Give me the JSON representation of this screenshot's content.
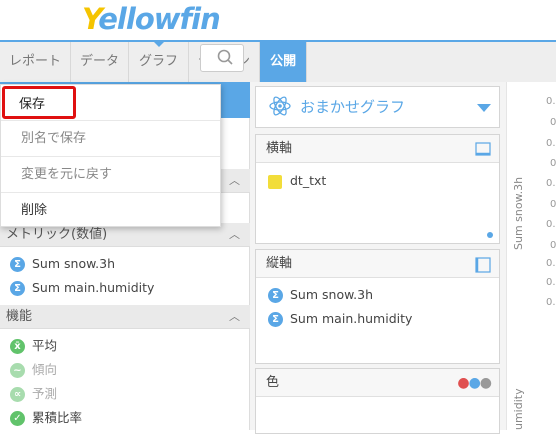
{
  "logo": {
    "y": "Y",
    "rest": "ellowfin"
  },
  "tabs": [
    {
      "label": "レポート"
    },
    {
      "label": "データ"
    },
    {
      "label": "グラフ"
    },
    {
      "label": "デザイン"
    },
    {
      "label": "公開"
    }
  ],
  "menu": {
    "save": "保存",
    "save_as": "別名で保存",
    "revert": "変更を元に戻す",
    "delete": "削除"
  },
  "left_panel": {
    "metrics_header": "メトリック(数値)",
    "metrics": [
      "Sum snow.3h",
      "Sum main.humidity"
    ],
    "functions_header": "機能",
    "functions": [
      {
        "label": "平均",
        "icon": "average-icon",
        "enabled": true
      },
      {
        "label": "傾向",
        "icon": "trend-icon",
        "enabled": false
      },
      {
        "label": "予測",
        "icon": "forecast-icon",
        "enabled": false
      },
      {
        "label": "累積比率",
        "icon": "cumulative-icon",
        "enabled": true
      }
    ]
  },
  "chart": {
    "selector_label": "おまかせグラフ",
    "x_axis_header": "横軸",
    "x_axis_fields": [
      "dt_txt"
    ],
    "y_axis_header": "縦軸",
    "y_axis_fields": [
      "Sum snow.3h",
      "Sum main.humidity"
    ],
    "color_header": "色"
  },
  "preview": {
    "y_label": "Sum snow.3h",
    "y_label2": "umidity",
    "ticks": [
      "0.",
      "0",
      "0.",
      "0",
      "0.",
      "0",
      "0.",
      "0",
      "0.",
      "0.",
      "0."
    ]
  },
  "colors": {
    "accent": "#5aa7e6",
    "highlight": "#e01010",
    "logo_yellow": "#f5c400"
  }
}
